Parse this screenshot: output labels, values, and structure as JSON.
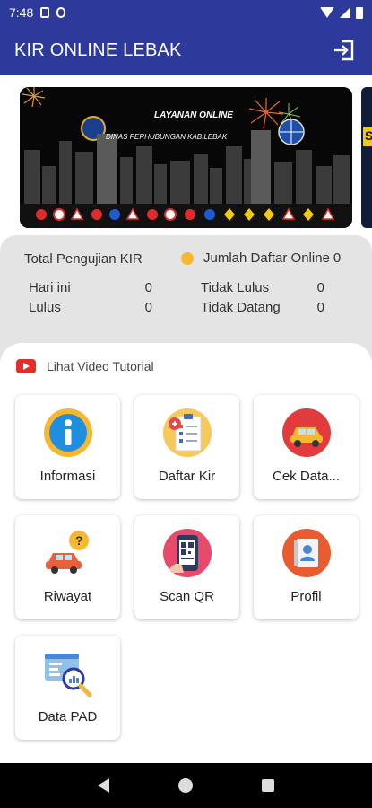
{
  "status_bar": {
    "time": "7:48"
  },
  "app_bar": {
    "title": "KIR ONLINE LEBAK",
    "login_icon": "login-icon"
  },
  "banner": {
    "title": "LAYANAN ONLINE",
    "subtitle": "DINAS PERHUBUNGAN KAB.LEBAK",
    "second_banner_letter": "S"
  },
  "stats": {
    "total_label": "Total Pengujian KIR",
    "online_label": "Jumlah Daftar Online",
    "online_value": "0",
    "online_dot_color": "#f5b82e",
    "hari_ini_label": "Hari ini",
    "hari_ini_value": "0",
    "lulus_label": "Lulus",
    "lulus_value": "0",
    "tidak_lulus_label": "Tidak Lulus",
    "tidak_lulus_value": "0",
    "tidak_datang_label": "Tidak Datang",
    "tidak_datang_value": "0"
  },
  "tutorial": {
    "label": "Lihat Video Tutorial",
    "icon": "youtube-icon"
  },
  "menu": {
    "informasi": {
      "label": "Informasi",
      "icon": "info-icon"
    },
    "daftar_kir": {
      "label": "Daftar Kir",
      "icon": "registration-form-icon"
    },
    "cek_data": {
      "label": "Cek Data...",
      "icon": "car-check-icon"
    },
    "riwayat": {
      "label": "Riwayat",
      "icon": "car-question-icon"
    },
    "scan_qr": {
      "label": "Scan QR",
      "icon": "qr-scan-icon"
    },
    "profil": {
      "label": "Profil",
      "icon": "profile-icon"
    },
    "data_pad": {
      "label": "Data PAD",
      "icon": "data-search-icon"
    }
  },
  "colors": {
    "primary": "#2d3a9c",
    "stats_bg": "#e4e4e4",
    "youtube": "#e52d27"
  }
}
